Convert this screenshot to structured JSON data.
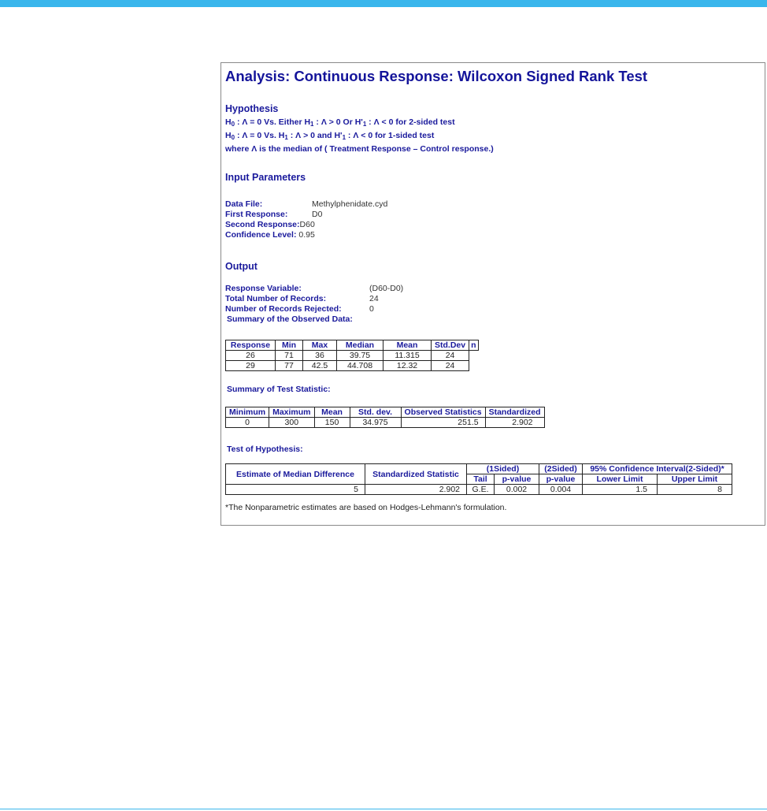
{
  "report": {
    "title": "Analysis: Continuous Response: Wilcoxon Signed Rank Test",
    "hypothesis": {
      "heading": "Hypothesis",
      "line1_a": "H",
      "line1_b": "0",
      "line1_c": " : Λ = 0 Vs. Either H",
      "line1_d": "1",
      "line1_e": " : Λ > 0 Or H'",
      "line1_f": "1",
      "line1_g": " : Λ < 0 for 2-sided test",
      "line2_a": "H",
      "line2_b": "0",
      "line2_c": " : Λ = 0 Vs. H",
      "line2_d": "1",
      "line2_e": " : Λ > 0 and H'",
      "line2_f": "1",
      "line2_g": " : Λ < 0 for 1-sided test",
      "line3": "where Λ is the median of ( Treatment Response – Control response.)"
    },
    "input_parameters": {
      "heading": "Input Parameters",
      "data_file_label": "Data File:",
      "data_file_value": "Methylphenidate.cyd",
      "first_response_label": "First Response:",
      "first_response_value": "D0",
      "second_response_label": "Second Response:",
      "second_response_value": "D60",
      "confidence_label": "Confidence Level:",
      "confidence_value": "0.95"
    },
    "output": {
      "heading": "Output",
      "response_variable_label": "Response Variable:",
      "response_variable_value": "(D60-D0)",
      "total_records_label": "Total Number of Records:",
      "total_records_value": "24",
      "rejected_label": "Number of Records Rejected:",
      "rejected_value": "0",
      "summary_observed_label": "Summary of the Observed Data:"
    },
    "observed_table": {
      "headers": [
        "Response",
        "Min",
        "Max",
        "Median",
        "Mean",
        "Std.Dev",
        "n"
      ],
      "rows": [
        [
          "26",
          "71",
          "36",
          "39.75",
          "11.315",
          "24"
        ],
        [
          "29",
          "77",
          "42.5",
          "44.708",
          "12.32",
          "24"
        ]
      ]
    },
    "test_statistic": {
      "heading": "Summary of Test Statistic:",
      "headers": [
        "Minimum",
        "Maximum",
        "Mean",
        "Std. dev.",
        "Observed Statistics",
        "Standardized"
      ],
      "row": [
        "0",
        "300",
        "150",
        "34.975",
        "251.5",
        "2.902"
      ]
    },
    "test_of_hypothesis": {
      "heading": "Test of Hypothesis:",
      "h_estimate": "Estimate of Median Difference",
      "h_standardized": "Standardized Statistic",
      "h_one_sided": "(1Sided)",
      "h_two_sided": "(2Sided)",
      "h_ci": "95% Confidence Interval(2-Sided)*",
      "h_tail": "Tail",
      "h_pvalue1": "p-value",
      "h_pvalue2": "p-value",
      "h_lower": "Lower Limit",
      "h_upper": "Upper Limit",
      "row": [
        "5",
        "2.902",
        "G.E.",
        "0.002",
        "0.004",
        "1.5",
        "8"
      ]
    },
    "footnote": "*The Nonparametric estimates are based on Hodges-Lehmann's formulation."
  }
}
